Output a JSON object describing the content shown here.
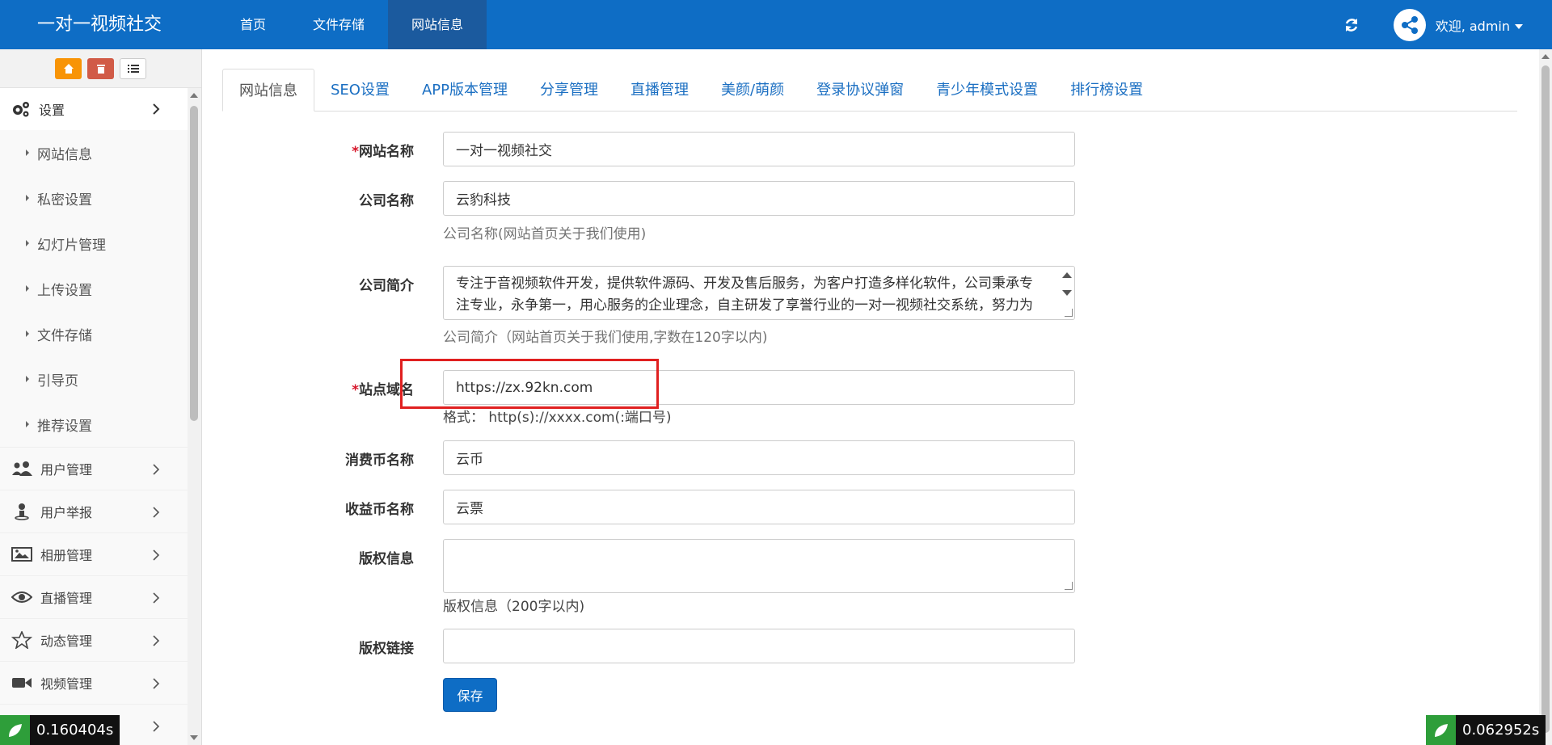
{
  "app": {
    "brand": "一对一视频社交"
  },
  "topnav": {
    "items": [
      {
        "label": "首页"
      },
      {
        "label": "文件存储"
      },
      {
        "label": "网站信息"
      }
    ],
    "active_index": 2,
    "user_label": "欢迎, admin"
  },
  "sidebar": {
    "settings_label": "设置",
    "sub_items": [
      {
        "label": "网站信息"
      },
      {
        "label": "私密设置"
      },
      {
        "label": "幻灯片管理"
      },
      {
        "label": "上传设置"
      },
      {
        "label": "文件存储"
      },
      {
        "label": "引导页"
      },
      {
        "label": "推荐设置"
      }
    ],
    "groups": [
      {
        "label": "用户管理",
        "icon": "users-icon"
      },
      {
        "label": "用户举报",
        "icon": "user-report-icon"
      },
      {
        "label": "相册管理",
        "icon": "image-icon"
      },
      {
        "label": "直播管理",
        "icon": "eye-icon"
      },
      {
        "label": "动态管理",
        "icon": "star-icon"
      },
      {
        "label": "视频管理",
        "icon": "video-camera-icon"
      }
    ]
  },
  "tabs": [
    {
      "label": "网站信息"
    },
    {
      "label": "SEO设置"
    },
    {
      "label": "APP版本管理"
    },
    {
      "label": "分享管理"
    },
    {
      "label": "直播管理"
    },
    {
      "label": "美颜/萌颜"
    },
    {
      "label": "登录协议弹窗"
    },
    {
      "label": "青少年模式设置"
    },
    {
      "label": "排行榜设置"
    }
  ],
  "form": {
    "site_name": {
      "required_mark": "*",
      "label": "网站名称",
      "value": "一对一视频社交"
    },
    "company_name": {
      "label": "公司名称",
      "value": "云豹科技",
      "help": "公司名称(网站首页关于我们使用)"
    },
    "company_intro": {
      "label": "公司简介",
      "value": "专注于音视频软件开发，提供软件源码、开发及售后服务，为客户打造多样化软件，公司秉承专注专业，永争第一，用心服务的企业理念，自主研发了享誉行业的一对一视频社交系统，努力为客户提供更好的产品",
      "help": "公司简介（网站首页关于我们使用,字数在120字以内)"
    },
    "site_domain": {
      "required_mark": "*",
      "label": "站点域名",
      "value": "https://zx.92kn.com",
      "help": "格式： http(s)://xxxx.com(:端口号)"
    },
    "coin_name": {
      "label": "消费币名称",
      "value": "云币"
    },
    "earn_name": {
      "label": "收益币名称",
      "value": "云票"
    },
    "copyright": {
      "label": "版权信息",
      "value": "",
      "help": "版权信息（200字以内)"
    },
    "copyright_link": {
      "label": "版权链接",
      "value": ""
    },
    "save_label": "保存"
  },
  "timers": {
    "left": "0.160404s",
    "right": "0.062952s"
  },
  "colors": {
    "topbar": "#0e6dc5",
    "accent": "#1b6fc2",
    "required": "#d6162a",
    "highlight": "#e02020"
  }
}
